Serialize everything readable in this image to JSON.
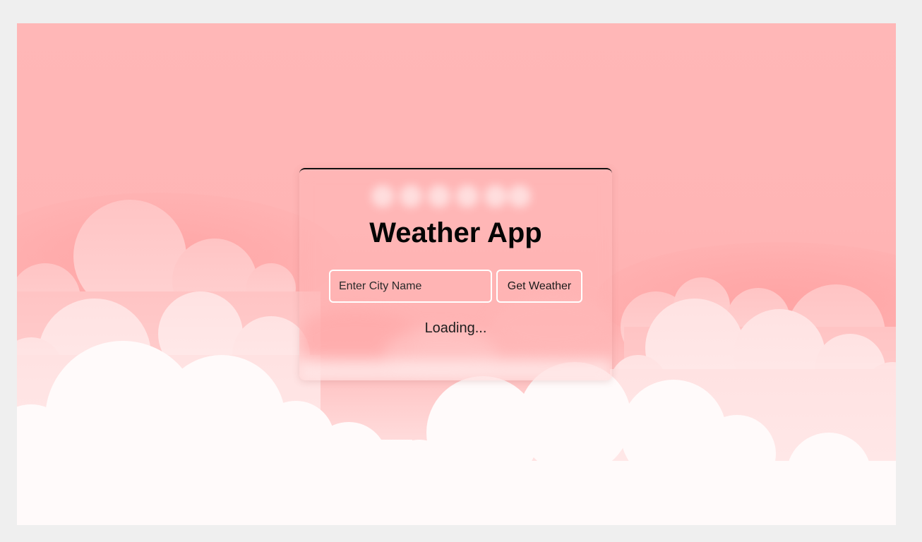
{
  "app": {
    "title": "Weather App"
  },
  "search": {
    "placeholder": "Enter City Name",
    "value": "",
    "button_label": "Get Weather"
  },
  "status": {
    "text": "Loading..."
  },
  "theme": {
    "sky_color": "#ffb7b7",
    "cloud_color": "#ffffff",
    "border_color": "#ffffff",
    "text_color": "#050505"
  }
}
